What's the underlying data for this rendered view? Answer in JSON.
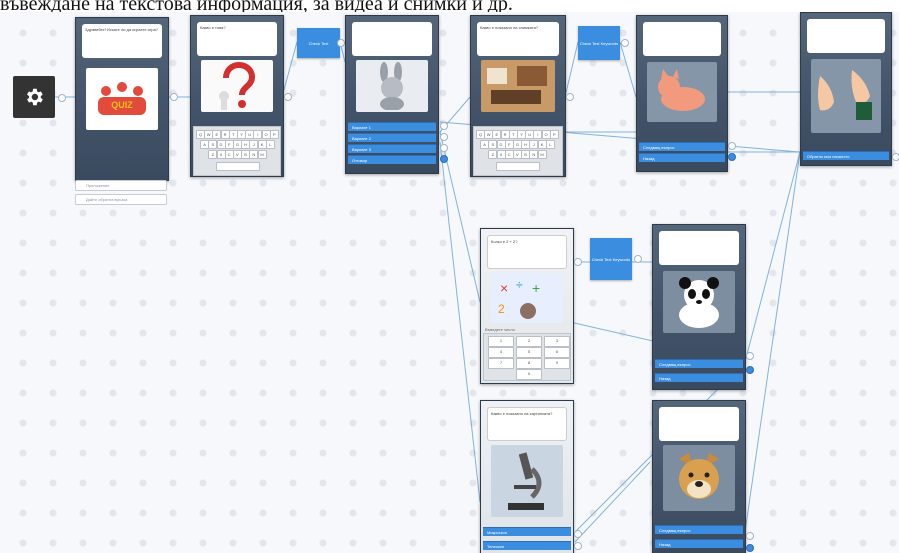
{
  "caption": "въвеждане на текстова информация, за видеа и снимки и др.",
  "settings_icon": "gear-icon",
  "colors": {
    "accent": "#3b8de0",
    "card": "#4b5c70",
    "canvas": "#f6f8fb"
  },
  "logic_nodes": [
    {
      "label": "Check Text"
    },
    {
      "label": "Check Text Keywords"
    },
    {
      "label": "Check Text Keywords"
    }
  ],
  "cards": {
    "start": {
      "bubble": "Здравейте! Искате ли да играете игра?",
      "image_text": "QUIZ"
    },
    "question": {
      "bubble": "Какво е това?"
    },
    "bunny": {
      "buttons": [
        "Вариант 1",
        "Вариант 2",
        "Вариант 3",
        "Отговор"
      ]
    },
    "photo": {
      "bubble": "Какво е показано на снимката?"
    },
    "cat": {
      "buttons": [
        "Следващ въпрос",
        "Назад"
      ]
    },
    "hands": {
      "buttons": [
        "Обратно към началото"
      ]
    },
    "math": {
      "bubble": "Колко е 2 + 2?",
      "input_label": "Въведете число"
    },
    "panda": {
      "buttons": [
        "Следващ въпрос",
        "Назад"
      ]
    },
    "microscope": {
      "bubble": "Какво е показано на картинката?",
      "buttons": [
        "Микроскоп",
        "Телескоп"
      ]
    },
    "dog": {
      "buttons": [
        "Следващ въпрос",
        "Назад"
      ]
    }
  },
  "start_fields": [
    "Приложение",
    "Дайте обратна връзка"
  ],
  "keyboard_rows": [
    [
      "Q",
      "W",
      "E",
      "R",
      "T",
      "Y",
      "U",
      "I",
      "O",
      "P"
    ],
    [
      "A",
      "S",
      "D",
      "F",
      "G",
      "H",
      "J",
      "K",
      "L"
    ],
    [
      "Z",
      "X",
      "C",
      "V",
      "B",
      "N",
      "M"
    ]
  ],
  "numpad_keys": [
    "1",
    "2",
    "3",
    "4",
    "5",
    "6",
    "7",
    "8",
    "9",
    "0"
  ]
}
